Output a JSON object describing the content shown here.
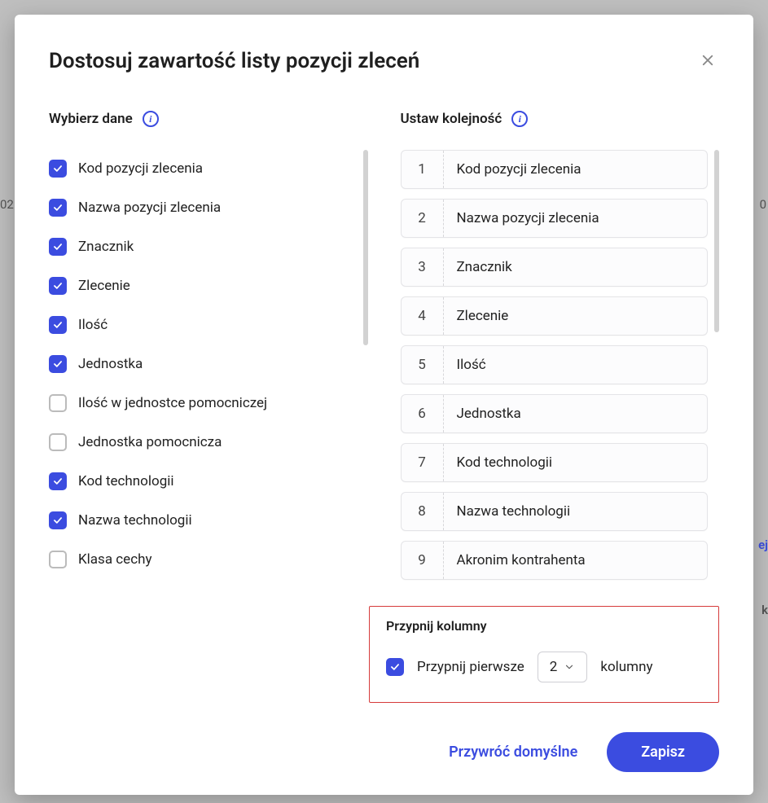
{
  "modal": {
    "title": "Dostosuj zawartość listy pozycji zleceń",
    "section_select": "Wybierz dane",
    "section_order": "Ustaw kolejność",
    "items": [
      {
        "label": "Kod pozycji zlecenia",
        "checked": true
      },
      {
        "label": "Nazwa pozycji zlecenia",
        "checked": true
      },
      {
        "label": "Znacznik",
        "checked": true
      },
      {
        "label": "Zlecenie",
        "checked": true
      },
      {
        "label": "Ilość",
        "checked": true
      },
      {
        "label": "Jednostka",
        "checked": true
      },
      {
        "label": "Ilość w jednostce pomocniczej",
        "checked": false
      },
      {
        "label": "Jednostka pomocnicza",
        "checked": false
      },
      {
        "label": "Kod technologii",
        "checked": true
      },
      {
        "label": "Nazwa technologii",
        "checked": true
      },
      {
        "label": "Klasa cechy",
        "checked": false
      }
    ],
    "order": [
      {
        "n": "1",
        "label": "Kod pozycji zlecenia"
      },
      {
        "n": "2",
        "label": "Nazwa pozycji zlecenia"
      },
      {
        "n": "3",
        "label": "Znacznik"
      },
      {
        "n": "4",
        "label": "Zlecenie"
      },
      {
        "n": "5",
        "label": "Ilość"
      },
      {
        "n": "6",
        "label": "Jednostka"
      },
      {
        "n": "7",
        "label": "Kod technologii"
      },
      {
        "n": "8",
        "label": "Nazwa technologii"
      },
      {
        "n": "9",
        "label": "Akronim kontrahenta"
      }
    ],
    "pin": {
      "title": "Przypnij kolumny",
      "before": "Przypnij pierwsze",
      "value": "2",
      "after": "kolumny",
      "checked": true
    },
    "footer": {
      "restore": "Przywróć domyślne",
      "save": "Zapisz"
    }
  },
  "background": {
    "left_fragment": "02",
    "right_fragment_1": "0",
    "right_fragment_2": "ej",
    "right_fragment_3": "k"
  }
}
